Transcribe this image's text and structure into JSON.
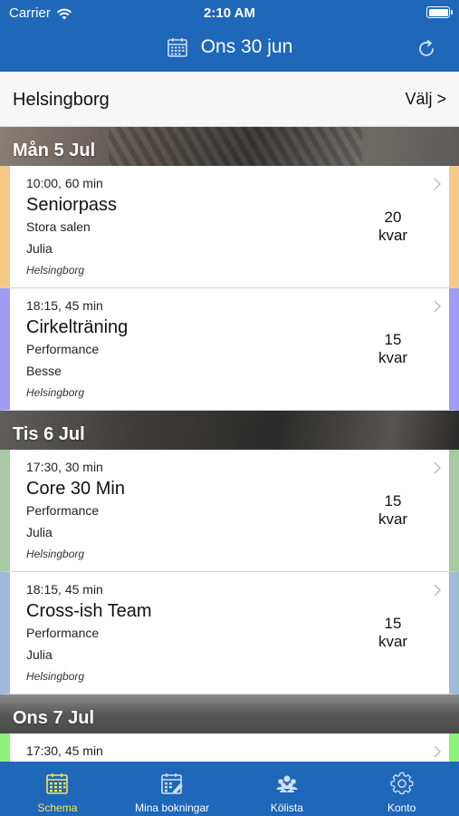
{
  "status_bar": {
    "carrier": "Carrier",
    "time": "2:10 AM"
  },
  "header": {
    "title": "Ons 30 jun"
  },
  "location": {
    "name": "Helsingborg",
    "choose_label": "Välj >"
  },
  "days": [
    {
      "label": "Mån 5 Jul",
      "classes": [
        {
          "time": "10:00, 60 min",
          "name": "Seniorpass",
          "room": "Stora salen",
          "trainer": "Julia",
          "location": "Helsingborg",
          "spots_count": "20",
          "spots_label": "kvar",
          "color": "#f5c98a"
        },
        {
          "time": "18:15, 45 min",
          "name": "Cirkelträning",
          "room": "Performance",
          "trainer": "Besse",
          "location": "Helsingborg",
          "spots_count": "15",
          "spots_label": "kvar",
          "color": "#9f9cf3"
        }
      ]
    },
    {
      "label": "Tis 6 Jul",
      "classes": [
        {
          "time": "17:30, 30 min",
          "name": "Core 30 Min",
          "room": "Performance",
          "trainer": "Julia",
          "location": "Helsingborg",
          "spots_count": "15",
          "spots_label": "kvar",
          "color": "#a9c9a4"
        },
        {
          "time": "18:15, 45 min",
          "name": "Cross-ish Team",
          "room": "Performance",
          "trainer": "Julia",
          "location": "Helsingborg",
          "spots_count": "15",
          "spots_label": "kvar",
          "color": "#9fbbd7"
        }
      ]
    },
    {
      "label": "Ons 7 Jul",
      "classes": [
        {
          "time": "17:30, 45 min",
          "color": "#8cf27a"
        }
      ]
    }
  ],
  "tabs": [
    {
      "label": "Schema",
      "icon": "calendar-icon",
      "active": true
    },
    {
      "label": "Mina bokningar",
      "icon": "calendar-edit-icon",
      "active": false
    },
    {
      "label": "Kölista",
      "icon": "group-icon",
      "active": false
    },
    {
      "label": "Konto",
      "icon": "gear-icon",
      "active": false
    }
  ],
  "colors": {
    "brand": "#1f67b9",
    "active_tab": "#f3e65a"
  }
}
